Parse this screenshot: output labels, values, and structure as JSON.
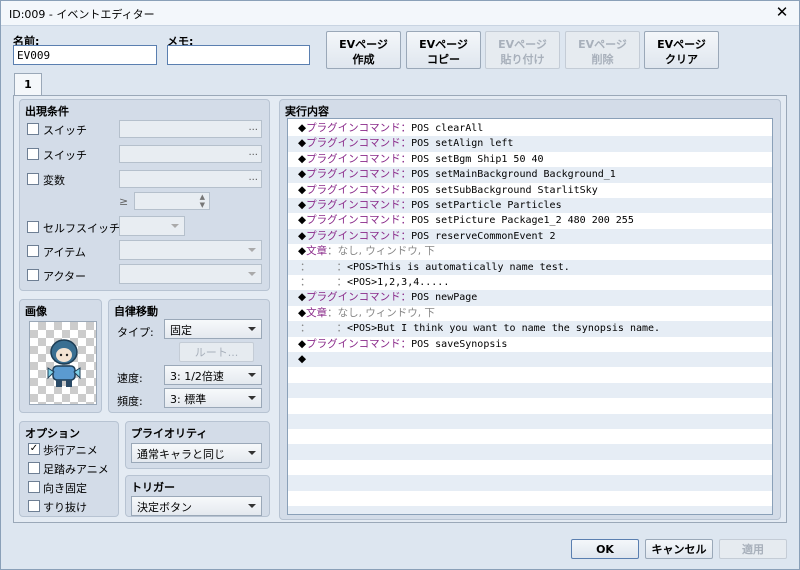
{
  "window": {
    "title": "ID:009 - イベントエディター",
    "close_label": "✕"
  },
  "name": {
    "label": "名前:",
    "value": "EV009"
  },
  "memo": {
    "label": "メモ:",
    "value": ""
  },
  "toolbar": {
    "create": [
      "EVページ",
      "作成"
    ],
    "copy": [
      "EVページ",
      "コピー"
    ],
    "paste": [
      "EVページ",
      "貼り付け"
    ],
    "delete": [
      "EVページ",
      "削除"
    ],
    "clear": [
      "EVページ",
      "クリア"
    ]
  },
  "tabs": [
    "1"
  ],
  "conditions": {
    "title": "出現条件",
    "switch1": "スイッチ",
    "switch2": "スイッチ",
    "variable": "変数",
    "ellipsis": "...",
    "gte": "≥",
    "self_switch": "セルフスイッチ",
    "item": "アイテム",
    "actor": "アクター"
  },
  "image": {
    "title": "画像"
  },
  "autonomous": {
    "title": "自律移動",
    "type_label": "タイプ:",
    "type_value": "固定",
    "route_button": "ルート...",
    "speed_label": "速度:",
    "speed_value": "3: 1/2倍速",
    "freq_label": "頻度:",
    "freq_value": "3: 標準"
  },
  "options": {
    "title": "オプション",
    "items": [
      {
        "label": "歩行アニメ",
        "checked": true
      },
      {
        "label": "足踏みアニメ",
        "checked": false
      },
      {
        "label": "向き固定",
        "checked": false
      },
      {
        "label": "すり抜け",
        "checked": false
      }
    ],
    "check_mark": "✓"
  },
  "priority": {
    "title": "プライオリティ",
    "value": "通常キャラと同じ"
  },
  "trigger": {
    "title": "トリガー",
    "value": "決定ボタン"
  },
  "contents": {
    "title": "実行内容",
    "rows": [
      {
        "d": "◆",
        "c": "プラグインコマンド：",
        "t": "POS clearAll"
      },
      {
        "d": "◆",
        "c": "プラグインコマンド：",
        "t": "POS setAlign left"
      },
      {
        "d": "◆",
        "c": "プラグインコマンド：",
        "t": "POS setBgm Ship1 50 40"
      },
      {
        "d": "◆",
        "c": "プラグインコマンド：",
        "t": "POS setMainBackground Background_1"
      },
      {
        "d": "◆",
        "c": "プラグインコマンド：",
        "t": "POS setSubBackground StarlitSky"
      },
      {
        "d": "◆",
        "c": "プラグインコマンド：",
        "t": "POS setParticle Particles"
      },
      {
        "d": "◆",
        "c": "プラグインコマンド：",
        "t": "POS setPicture Package1_2 480 200 255"
      },
      {
        "d": "◆",
        "c": "プラグインコマンド：",
        "t": "POS reserveCommonEvent 2"
      },
      {
        "d": "◆",
        "c": "文章",
        "t": "：なし, ウィンドウ, 下"
      },
      {
        "d": "：",
        "c": "：",
        "t": "<POS>This is automatically name test."
      },
      {
        "d": "：",
        "c": "：",
        "t": "<POS>1,2,3,4....."
      },
      {
        "d": "◆",
        "c": "プラグインコマンド：",
        "t": "POS newPage"
      },
      {
        "d": "◆",
        "c": "文章",
        "t": "：なし, ウィンドウ, 下"
      },
      {
        "d": "：",
        "c": "：",
        "t": "<POS>But I think you want to name the synopsis name."
      },
      {
        "d": "◆",
        "c": "プラグインコマンド：",
        "t": "POS saveSynopsis"
      },
      {
        "d": "◆",
        "c": "",
        "t": ""
      }
    ]
  },
  "footer": {
    "ok": "OK",
    "cancel": "キャンセル",
    "apply": "適用"
  }
}
